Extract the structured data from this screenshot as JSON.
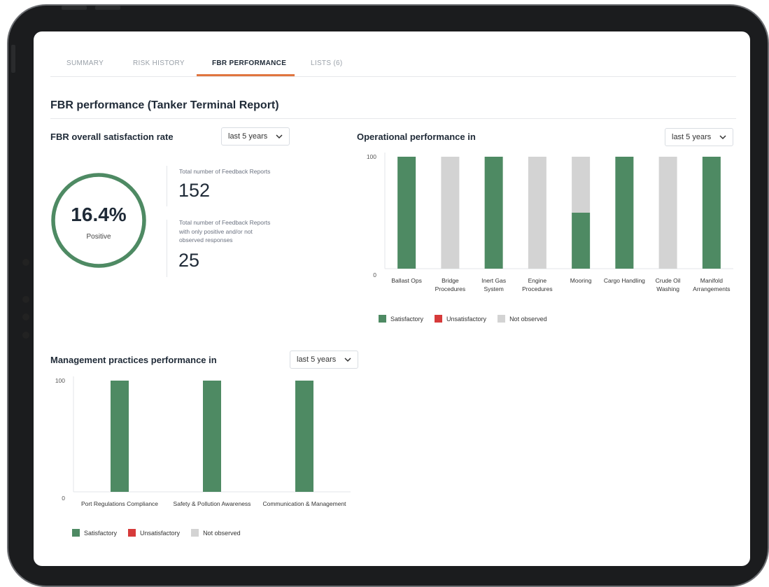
{
  "tabs": [
    {
      "label": "SUMMARY"
    },
    {
      "label": "RISK HISTORY"
    },
    {
      "label": "FBR PERFORMANCE"
    },
    {
      "label": "LISTS (6)"
    }
  ],
  "active_tab": "FBR PERFORMANCE",
  "page_title": "FBR performance (Tanker Terminal Report)",
  "satisfaction": {
    "title": "FBR overall satisfaction rate",
    "dropdown": "last 5 years",
    "percent_text": "16.4%",
    "percent_value": 16.4,
    "percent_label": "Positive",
    "total_label": "Total number of Feedback Reports",
    "total_value": "152",
    "positive_label": "Total number of Feedback Reports with only positive and/or not observed responses",
    "positive_value": "25"
  },
  "operational": {
    "title": "Operational performance in",
    "dropdown": "last 5 years"
  },
  "management": {
    "title": "Management practices performance in",
    "dropdown": "last 5 years"
  },
  "legend": [
    {
      "label": "Satisfactory",
      "color": "#4e8a63"
    },
    {
      "label": "Unsatisfactory",
      "color": "#d63a3a"
    },
    {
      "label": "Not observed",
      "color": "#d3d3d3"
    }
  ],
  "colors": {
    "satisfactory": "#4e8a63",
    "unsatisfactory": "#d63a3a",
    "not_observed": "#d3d3d3",
    "accent": "#e0753f"
  },
  "chart_data": [
    {
      "type": "bar",
      "stacked": true,
      "title": "Operational performance in",
      "categories": [
        "Ballast Ops",
        "Bridge Procedures",
        "Inert Gas System",
        "Engine Procedures",
        "Mooring",
        "Cargo Handling",
        "Crude Oil Washing",
        "Manifold Arrangements"
      ],
      "category_lines": [
        [
          "Ballast Ops"
        ],
        [
          "Bridge",
          "Procedures"
        ],
        [
          "Inert Gas",
          "System"
        ],
        [
          "Engine",
          "Procedures"
        ],
        [
          "Mooring"
        ],
        [
          "Cargo Handling"
        ],
        [
          "Crude Oil",
          "Washing"
        ],
        [
          "Manifold",
          "Arrangements"
        ]
      ],
      "series": [
        {
          "name": "Satisfactory",
          "values": [
            100,
            0,
            100,
            0,
            50,
            100,
            0,
            100
          ]
        },
        {
          "name": "Unsatisfactory",
          "values": [
            0,
            0,
            0,
            0,
            0,
            0,
            0,
            0
          ]
        },
        {
          "name": "Not observed",
          "values": [
            0,
            100,
            0,
            100,
            50,
            0,
            100,
            0
          ]
        }
      ],
      "ylim": [
        0,
        100
      ],
      "yticks": [
        "0",
        "100"
      ],
      "legend": "bottom-left"
    },
    {
      "type": "bar",
      "stacked": true,
      "title": "Management practices performance in",
      "categories": [
        "Port Regulations Compliance",
        "Safety & Pollution Awareness",
        "Communication & Management"
      ],
      "category_lines": [
        [
          "Port Regulations Compliance"
        ],
        [
          "Safety & Pollution Awareness"
        ],
        [
          "Communication & Management"
        ]
      ],
      "series": [
        {
          "name": "Satisfactory",
          "values": [
            100,
            100,
            100
          ]
        },
        {
          "name": "Unsatisfactory",
          "values": [
            0,
            0,
            0
          ]
        },
        {
          "name": "Not observed",
          "values": [
            0,
            0,
            0
          ]
        }
      ],
      "ylim": [
        0,
        100
      ],
      "yticks": [
        "0",
        "100"
      ],
      "legend": "bottom-left"
    }
  ]
}
